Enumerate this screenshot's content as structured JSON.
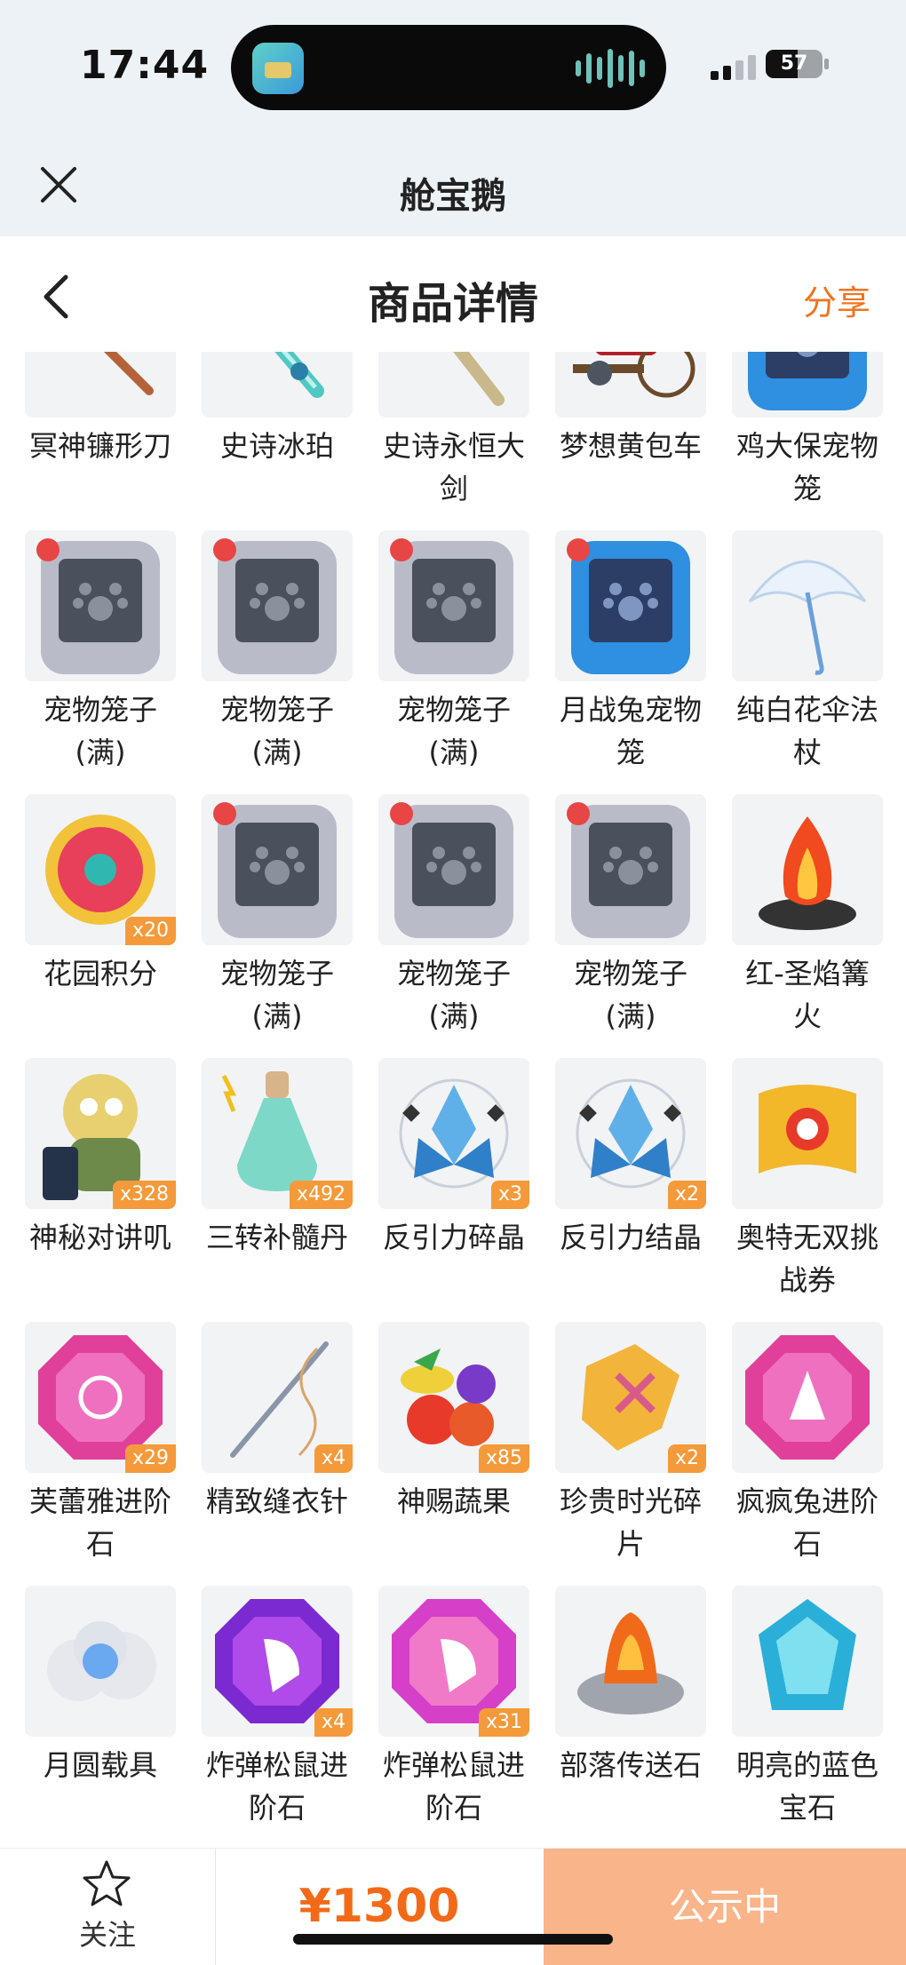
{
  "status_bar": {
    "time": "17:44",
    "battery": "57",
    "battery_level": 0.57
  },
  "app": {
    "title": "舱宝鹅"
  },
  "page": {
    "title": "商品详情",
    "share_label": "分享"
  },
  "rows": [
    [
      {
        "name": "冥神镰形刀",
        "badge": "",
        "art": "scythe"
      },
      {
        "name": "史诗冰珀",
        "badge": "",
        "art": "icesword"
      },
      {
        "name": "史诗永恒大剑",
        "badge": "",
        "art": "greatsword"
      },
      {
        "name": "梦想黄包车",
        "badge": "",
        "art": "rickshaw"
      },
      {
        "name": "鸡大保宠物笼",
        "badge": "",
        "art": "cage-blue"
      }
    ],
    [
      {
        "name": "宠物笼子(满)",
        "badge": "",
        "art": "cage-gray"
      },
      {
        "name": "宠物笼子(满)",
        "badge": "",
        "art": "cage-gray"
      },
      {
        "name": "宠物笼子(满)",
        "badge": "",
        "art": "cage-gray"
      },
      {
        "name": "月战兔宠物笼",
        "badge": "",
        "art": "cage-blue"
      },
      {
        "name": "纯白花伞法杖",
        "badge": "",
        "art": "umbrella"
      }
    ],
    [
      {
        "name": "花园积分",
        "badge": "x20",
        "art": "flower"
      },
      {
        "name": "宠物笼子(满)",
        "badge": "",
        "art": "cage-gray"
      },
      {
        "name": "宠物笼子(满)",
        "badge": "",
        "art": "cage-gray"
      },
      {
        "name": "宠物笼子(满)",
        "badge": "",
        "art": "cage-gray"
      },
      {
        "name": "红-圣焰篝火",
        "badge": "",
        "art": "bonfire"
      }
    ],
    [
      {
        "name": "神秘对讲叽",
        "badge": "x328",
        "art": "walkie"
      },
      {
        "name": "三转补髓丹",
        "badge": "x492",
        "art": "bottle"
      },
      {
        "name": "反引力碎晶",
        "badge": "x3",
        "art": "crystal"
      },
      {
        "name": "反引力结晶",
        "badge": "x2",
        "art": "crystal"
      },
      {
        "name": "奥特无双挑战券",
        "badge": "",
        "art": "scroll"
      }
    ],
    [
      {
        "name": "芙蕾雅进阶石",
        "badge": "x29",
        "art": "gem-pink"
      },
      {
        "name": "精致缝衣针",
        "badge": "x4",
        "art": "needle"
      },
      {
        "name": "神赐蔬果",
        "badge": "x85",
        "art": "veggies"
      },
      {
        "name": "珍贵时光碎片",
        "badge": "x2",
        "art": "shard"
      },
      {
        "name": "疯疯兔进阶石",
        "badge": "",
        "art": "gem-pink2"
      }
    ],
    [
      {
        "name": "月圆载具",
        "badge": "",
        "art": "cloud"
      },
      {
        "name": "炸弹松鼠进阶石",
        "badge": "x4",
        "art": "gem-purple"
      },
      {
        "name": "炸弹松鼠进阶石",
        "badge": "x31",
        "art": "gem-pink3"
      },
      {
        "name": "部落传送石",
        "badge": "",
        "art": "portal"
      },
      {
        "name": "明亮的蓝色宝石",
        "badge": "",
        "art": "bluegem"
      }
    ]
  ],
  "bottom_bar": {
    "follow_label": "关注",
    "price": "¥1300",
    "cta_label": "公示中"
  },
  "colors": {
    "accent": "#f26a18",
    "share": "#f07420",
    "cta_bg": "#f9b48a",
    "badge_bg": "#f59a3a"
  }
}
